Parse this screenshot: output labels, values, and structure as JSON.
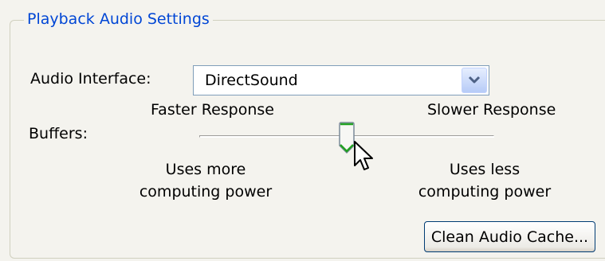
{
  "group": {
    "title": "Playback Audio Settings"
  },
  "audio_interface": {
    "label": "Audio Interface:",
    "value": "DirectSound",
    "dropdown_icon": "chevron-down-icon"
  },
  "buffers": {
    "label": "Buffers:",
    "left_caption": "Faster Response",
    "right_caption": "Slower Response",
    "left_note_line1": "Uses more",
    "left_note_line2": "computing power",
    "right_note_line1": "Uses less",
    "right_note_line2": "computing power",
    "slider_position": 0.5
  },
  "clean_cache_button": {
    "label": "Clean Audio Cache..."
  },
  "colors": {
    "title": "#0046d5",
    "thumb_accent": "#21a121",
    "panel_background": "#f4f3ee"
  }
}
